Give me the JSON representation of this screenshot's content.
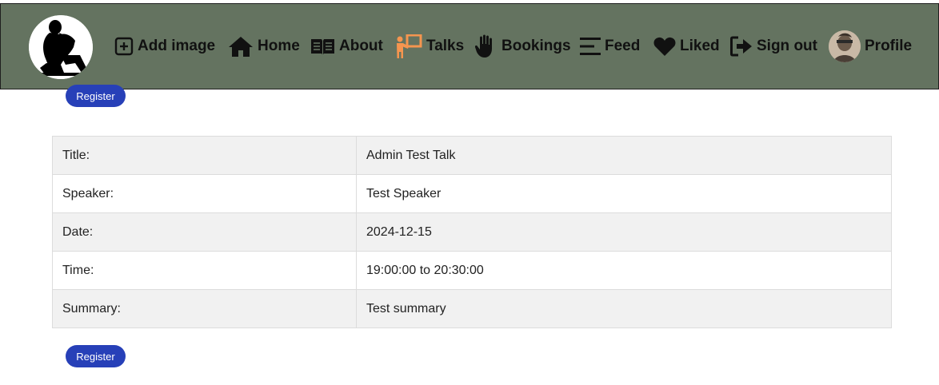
{
  "nav": {
    "items": [
      {
        "label": "Add image",
        "icon": "plus-square-icon"
      },
      {
        "label": "Home",
        "icon": "home-icon"
      },
      {
        "label": "About",
        "icon": "book-open-icon"
      },
      {
        "label": "Talks",
        "icon": "presenter-icon",
        "active": true
      },
      {
        "label": "Bookings",
        "icon": "hand-icon"
      },
      {
        "label": "Feed",
        "icon": "feed-lines-icon"
      },
      {
        "label": "Liked",
        "icon": "heart-icon"
      },
      {
        "label": "Sign out",
        "icon": "sign-out-icon"
      },
      {
        "label": "Profile",
        "icon": "avatar"
      }
    ]
  },
  "talk": {
    "register_label": "Register",
    "rows": [
      {
        "label": "Title:",
        "value": "Admin Test Talk"
      },
      {
        "label": "Speaker:",
        "value": "Test Speaker"
      },
      {
        "label": "Date:",
        "value": "2024-12-15"
      },
      {
        "label": "Time:",
        "value": "19:00:00 to 20:30:00"
      },
      {
        "label": "Summary:",
        "value": "Test summary"
      }
    ]
  },
  "colors": {
    "navbar_bg": "#647360",
    "active_nav": "#f5954f",
    "button_bg": "#2740b8",
    "row_alt": "#f1f1f1"
  }
}
